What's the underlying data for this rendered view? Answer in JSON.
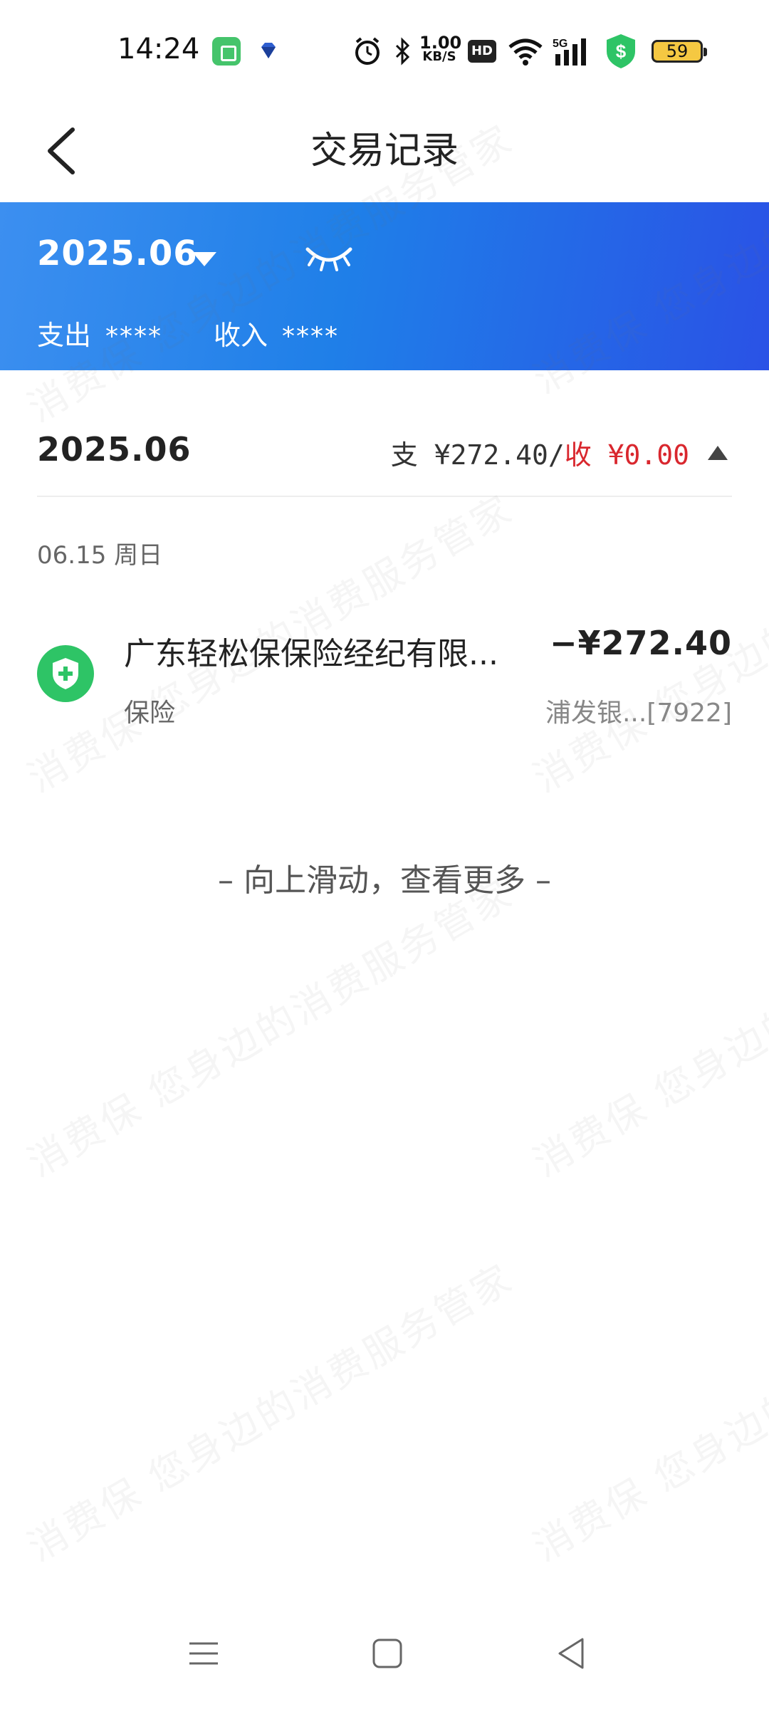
{
  "status_bar": {
    "time": "14:24",
    "net_speed_value": "1.00",
    "net_speed_unit": "KB/S",
    "hd_label": "HD",
    "signal_label": "5G",
    "battery": "59"
  },
  "header": {
    "title": "交易记录"
  },
  "banner": {
    "month": "2025.06",
    "expense_label": "支出",
    "expense_value": "****",
    "income_label": "收入",
    "income_value": "****"
  },
  "month_summary": {
    "month": "2025.06",
    "expense_prefix": "支 ",
    "expense_amount": "¥272.40/",
    "income_prefix": "收 ",
    "income_amount": "¥0.00"
  },
  "date_group": {
    "label": "06.15 周日"
  },
  "transactions": [
    {
      "name": "广东轻松保保险经纪有限...",
      "amount": "−¥272.40",
      "category": "保险",
      "account": "浦发银...[7922]"
    }
  ],
  "more_hint": "– 向上滑动，查看更多 –",
  "watermark": "消费保 您身边的消费服务管家",
  "colors": {
    "banner_start": "#3c8ff0",
    "banner_end": "#2a52e6",
    "income_red": "#d9272e",
    "txn_icon_green": "#2ec466"
  }
}
